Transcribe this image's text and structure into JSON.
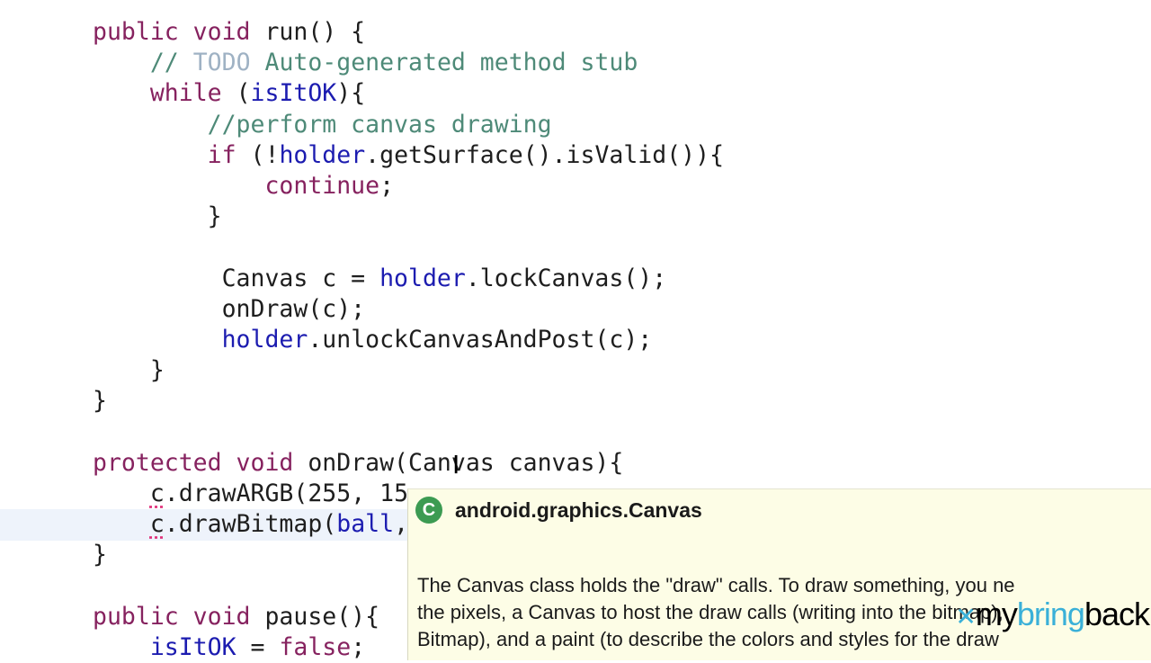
{
  "code": [
    [
      {
        "t": "public void ",
        "c": "k"
      },
      {
        "t": "run() {",
        "c": ""
      }
    ],
    [
      {
        "t": "    ",
        "c": ""
      },
      {
        "t": "// ",
        "c": "c"
      },
      {
        "t": "TODO",
        "c": "t"
      },
      {
        "t": " Auto-generated method stub",
        "c": "c"
      }
    ],
    [
      {
        "t": "    ",
        "c": ""
      },
      {
        "t": "while",
        "c": "k"
      },
      {
        "t": " (",
        "c": ""
      },
      {
        "t": "isItOK",
        "c": "f"
      },
      {
        "t": "){",
        "c": ""
      }
    ],
    [
      {
        "t": "        ",
        "c": ""
      },
      {
        "t": "//perform canvas drawing",
        "c": "c"
      }
    ],
    [
      {
        "t": "        ",
        "c": ""
      },
      {
        "t": "if",
        "c": "k"
      },
      {
        "t": " (!",
        "c": ""
      },
      {
        "t": "holder",
        "c": "f"
      },
      {
        "t": ".getSurface().isValid()){",
        "c": ""
      }
    ],
    [
      {
        "t": "            ",
        "c": ""
      },
      {
        "t": "continue",
        "c": "k"
      },
      {
        "t": ";",
        "c": ""
      }
    ],
    [
      {
        "t": "        }",
        "c": ""
      }
    ],
    [],
    [
      {
        "t": "         Canvas c = ",
        "c": ""
      },
      {
        "t": "holder",
        "c": "f"
      },
      {
        "t": ".lockCanvas();",
        "c": ""
      }
    ],
    [
      {
        "t": "         onDraw(c);",
        "c": ""
      }
    ],
    [
      {
        "t": "         ",
        "c": ""
      },
      {
        "t": "holder",
        "c": "f"
      },
      {
        "t": ".unlockCanvasAndPost(c);",
        "c": ""
      }
    ],
    [
      {
        "t": "    }",
        "c": ""
      }
    ],
    [
      {
        "t": "}",
        "c": ""
      }
    ],
    [],
    [
      {
        "t": "protected void ",
        "c": "k"
      },
      {
        "t": "onDraw(Canvas canvas){",
        "c": ""
      }
    ],
    [
      {
        "t": "    ",
        "c": ""
      },
      {
        "t": "c",
        "c": "err"
      },
      {
        "t": ".drawARGB(255, 15",
        "c": ""
      }
    ],
    [
      {
        "t": "    ",
        "c": ""
      },
      {
        "t": "c",
        "c": "err"
      },
      {
        "t": ".drawBitmap(",
        "c": ""
      },
      {
        "t": "ball",
        "c": "f"
      },
      {
        "t": ",",
        "c": ""
      }
    ],
    [
      {
        "t": "}",
        "c": ""
      }
    ],
    [],
    [
      {
        "t": "public void ",
        "c": "k"
      },
      {
        "t": "pause(){",
        "c": ""
      }
    ],
    [
      {
        "t": "    ",
        "c": ""
      },
      {
        "t": "isItOK",
        "c": "f"
      },
      {
        "t": " = ",
        "c": ""
      },
      {
        "t": "false",
        "c": "k"
      },
      {
        "t": ";",
        "c": ""
      }
    ]
  ],
  "tooltip": {
    "icon": "class-icon",
    "icon_letter": "C",
    "title": "android.graphics.Canvas",
    "lines": [
      "The Canvas class holds the \"draw\" calls. To draw something, you ne",
      "the pixels, a Canvas to host the draw calls (writing into the bitmap),",
      "Bitmap), and a paint (to describe the colors and styles for the draw"
    ]
  },
  "watermark": {
    "part1": "my",
    "part2": "bring",
    "part3": "back"
  }
}
